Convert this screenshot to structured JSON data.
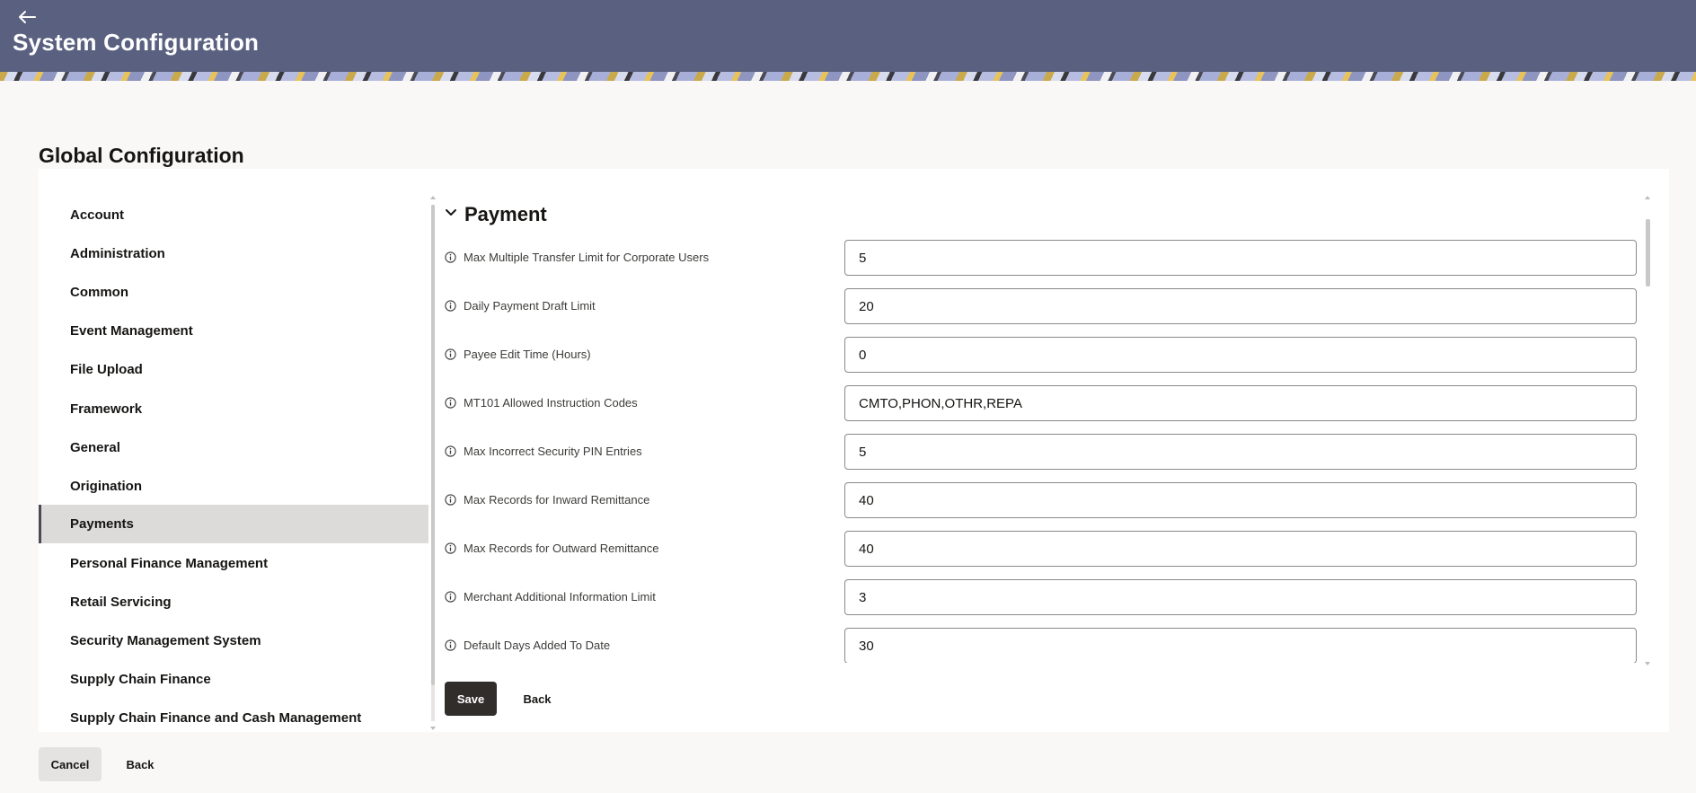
{
  "header": {
    "back_icon": "arrow-left-icon",
    "title": "System Configuration",
    "background_color": "#5a6180"
  },
  "page": {
    "title": "Global Configuration"
  },
  "sidebar": {
    "items": [
      {
        "label": "Account"
      },
      {
        "label": "Administration"
      },
      {
        "label": "Common"
      },
      {
        "label": "Event Management"
      },
      {
        "label": "File Upload"
      },
      {
        "label": "Framework"
      },
      {
        "label": "General"
      },
      {
        "label": "Origination"
      },
      {
        "label": "Payments",
        "active": true
      },
      {
        "label": "Personal Finance Management"
      },
      {
        "label": "Retail Servicing"
      },
      {
        "label": "Security Management System"
      },
      {
        "label": "Supply Chain Finance"
      },
      {
        "label": "Supply Chain Finance and Cash Management"
      }
    ]
  },
  "section": {
    "toggle_icon": "chevron-down-icon",
    "title": "Payment",
    "fields": [
      {
        "label": "Max Multiple Transfer Limit for Corporate Users",
        "value": "5"
      },
      {
        "label": "Daily Payment Draft Limit",
        "value": "20"
      },
      {
        "label": "Payee Edit Time (Hours)",
        "value": "0"
      },
      {
        "label": "MT101 Allowed Instruction Codes",
        "value": "CMTO,PHON,OTHR,REPA"
      },
      {
        "label": "Max Incorrect Security PIN Entries",
        "value": "5"
      },
      {
        "label": "Max Records for Inward Remittance",
        "value": "40"
      },
      {
        "label": "Max Records for Outward Remittance",
        "value": "40"
      },
      {
        "label": "Merchant Additional Information Limit",
        "value": "3"
      },
      {
        "label": "Default Days Added To Date",
        "value": "30"
      }
    ]
  },
  "actions": {
    "save_label": "Save",
    "back_label": "Back",
    "primary_color": "#312d2a"
  },
  "footer": {
    "cancel_label": "Cancel",
    "back_label": "Back"
  }
}
